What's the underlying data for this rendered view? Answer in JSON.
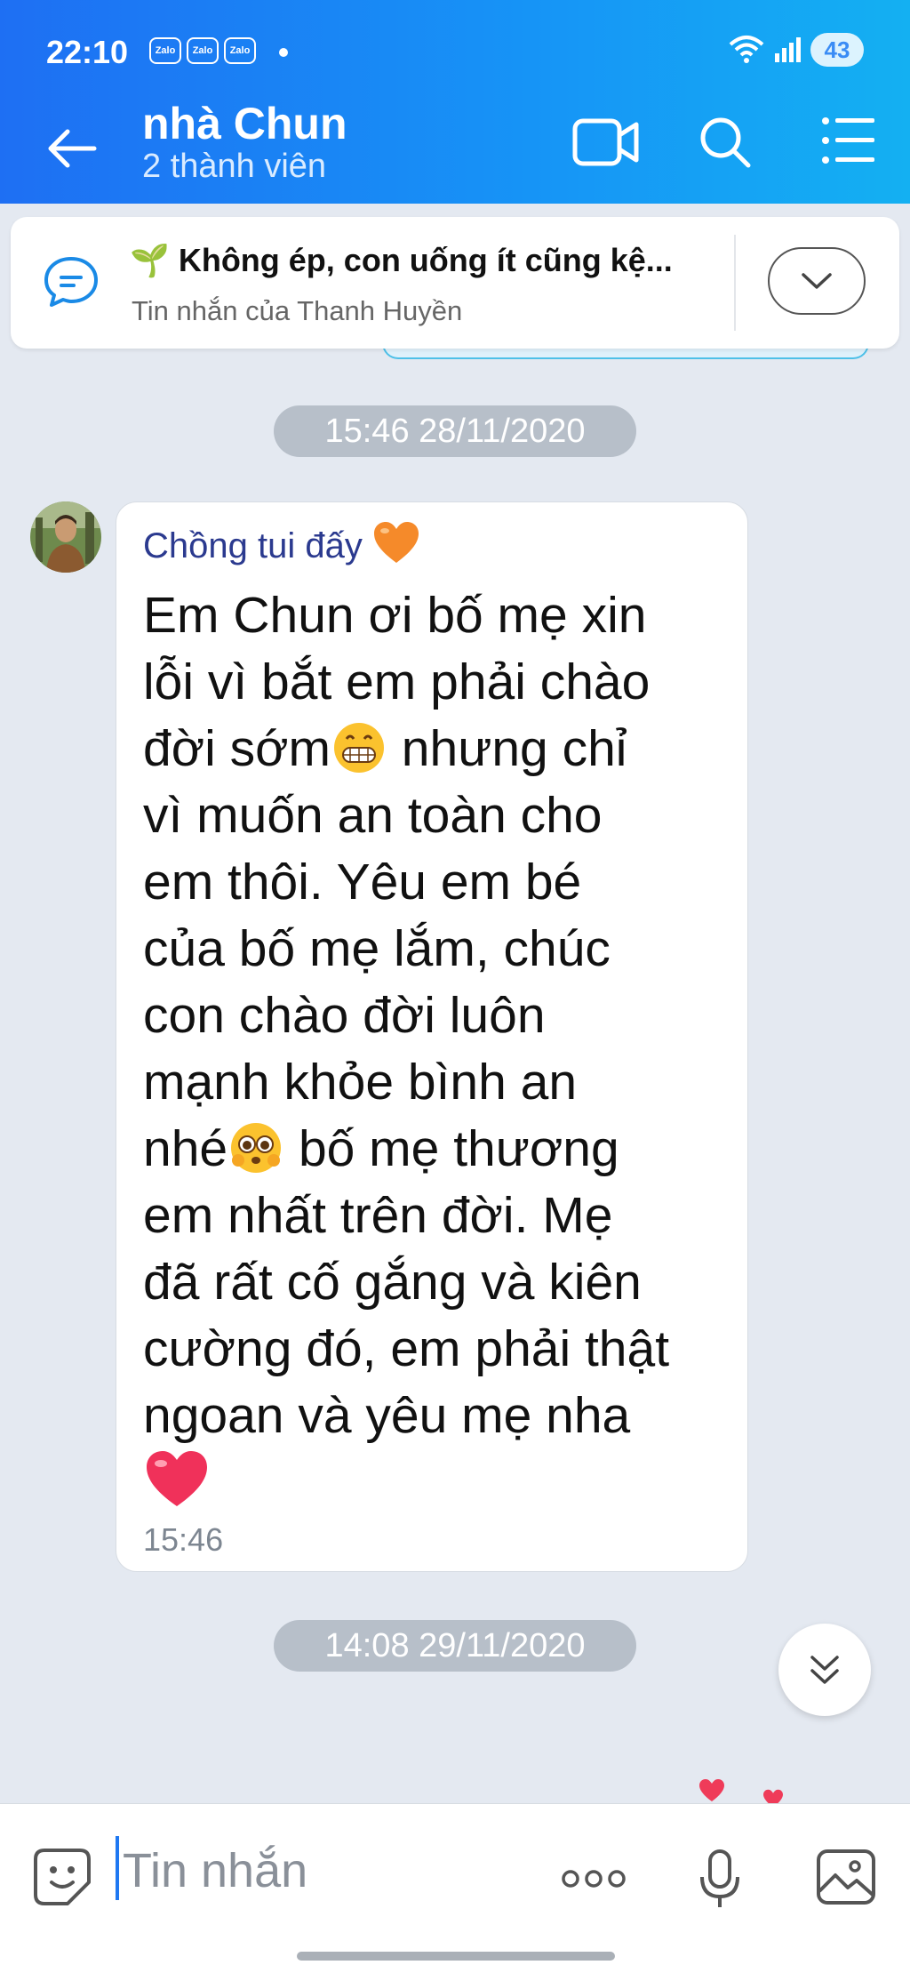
{
  "status_bar": {
    "time": "22:10",
    "notification_icons": [
      "Zalo",
      "Zalo",
      "Zalo"
    ],
    "battery": "43"
  },
  "header": {
    "title": "nhà Chun",
    "subtitle": "2 thành viên",
    "icons": [
      "back-arrow-icon",
      "video-call-icon",
      "search-icon",
      "menu-list-icon"
    ]
  },
  "pinned": {
    "title": "🌱 Không ép, con uống ít cũng kệ...",
    "subtitle": "Tin nhắn của Thanh Huyền"
  },
  "date_separators": [
    "15:46 28/11/2020",
    "14:08 29/11/2020"
  ],
  "message": {
    "sender": "Chồng tui đấy",
    "line1": "Em Chun ơi bố mẹ xin\nlỗi vì bắt em phải chào\nđời sớm",
    "line2": " nhưng chỉ\nvì muốn an toàn cho\nem thôi. Yêu em bé\ncủa bố mẹ lắm, chúc\ncon chào đời luôn\nmạnh khỏe bình an\nnhé",
    "line3": " bố mẹ thương\nem nhất trên đời. Mẹ\nđã rất cố gắng và kiên\ncường đó, em phải thật\nngoan và yêu mẹ nha\n",
    "time": "15:46"
  },
  "input": {
    "placeholder": "Tin nhắn"
  },
  "colors": {
    "header_gradient_start": "#1e6ff3",
    "header_gradient_end": "#14b0f2",
    "chat_background": "#e4e9f1",
    "sender_name": "#2b3a8f"
  }
}
